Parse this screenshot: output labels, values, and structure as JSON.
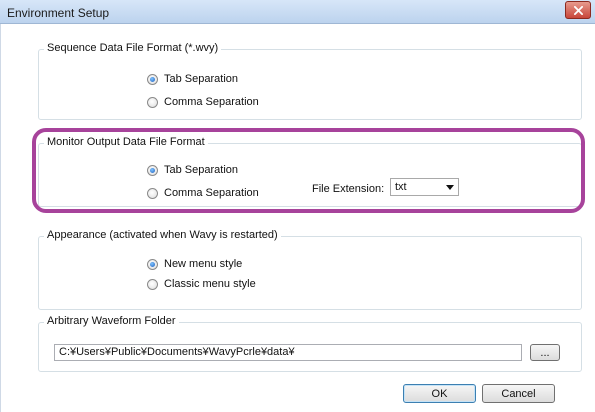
{
  "window": {
    "title": "Environment Setup"
  },
  "sequence_group": {
    "legend": "Sequence Data File Format (*.wvy)",
    "options": [
      {
        "label": "Tab Separation",
        "checked": true
      },
      {
        "label": "Comma Separation",
        "checked": false
      }
    ]
  },
  "monitor_group": {
    "legend": "Monitor Output Data File Format",
    "options": [
      {
        "label": "Tab Separation",
        "checked": true
      },
      {
        "label": "Comma Separation",
        "checked": false
      }
    ],
    "file_extension_label": "File Extension:",
    "file_extension_value": "txt"
  },
  "appearance_group": {
    "legend": "Appearance (activated when Wavy is restarted)",
    "options": [
      {
        "label": "New menu style",
        "checked": true
      },
      {
        "label": "Classic menu style",
        "checked": false
      }
    ]
  },
  "waveform_group": {
    "legend": "Arbitrary Waveform Folder",
    "path_value": "C:¥Users¥Public¥Documents¥WavyPcrle¥data¥",
    "browse_label": "..."
  },
  "buttons": {
    "ok_label": "OK",
    "cancel_label": "Cancel"
  },
  "colors": {
    "highlight": "#a7439b",
    "radio_selected": "#1f5fbf",
    "close_button": "#c8463a"
  },
  "icons": {
    "close": "close-icon",
    "dropdown": "chevron-down-icon"
  }
}
